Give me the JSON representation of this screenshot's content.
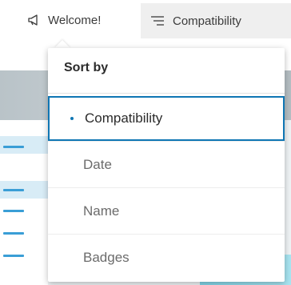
{
  "topbar": {
    "welcome_label": "Welcome!",
    "welcome_icon": "megaphone-icon",
    "sort_label": "Compatibility",
    "sort_icon": "sort-lines-icon"
  },
  "menu": {
    "header": "Sort by",
    "items": [
      {
        "label": "Compatibility",
        "selected": true
      },
      {
        "label": "Date",
        "selected": false
      },
      {
        "label": "Name",
        "selected": false
      },
      {
        "label": "Badges",
        "selected": false
      }
    ]
  },
  "colors": {
    "accent": "#0f76b4",
    "sort_button_bg": "#efefef"
  }
}
